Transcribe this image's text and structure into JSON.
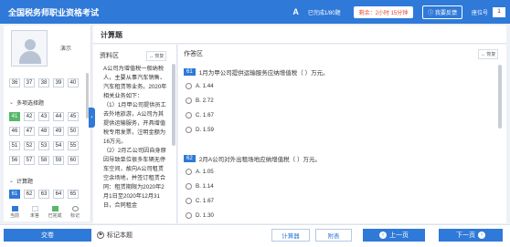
{
  "app": {
    "title": "全国税务师职业资格考试",
    "font_toggle": "A",
    "done_count": "已完成1/80题",
    "timer": "剩余：2小时 15分钟",
    "feedback": "我要反馈",
    "seat_label": "座位号",
    "seat_number": "1"
  },
  "sidebar": {
    "demo_name": "演示",
    "row_top": [
      "36",
      "37",
      "38",
      "39",
      "40"
    ],
    "section_multi": "多项选择题",
    "multi_rows": [
      [
        "41",
        "42",
        "43",
        "44",
        "45"
      ],
      [
        "46",
        "47",
        "48",
        "49",
        "50"
      ],
      [
        "51",
        "52",
        "53",
        "54",
        "55"
      ],
      [
        "56",
        "57",
        "58",
        "59",
        "60"
      ]
    ],
    "section_calc": "计算题",
    "calc_row": [
      "61",
      "62",
      "63",
      "64",
      "65"
    ],
    "legend": [
      "当前",
      "未答",
      "已完成",
      "标记"
    ]
  },
  "main": {
    "section_title": "计算题",
    "material_header": "资料区",
    "answer_header": "作答区",
    "restore": "恢复",
    "material_text": "A公司为增值税一般纳税人，主要从事汽车销售、汽车租赁等业务。2020年相关业务如下：\n（1）1月甲公司提供员工去外地旅游，A公司为其提供运输服务，开具增值税专用发票，注明金额为16万元。\n（2）2月乙公司因自身原因导致单位很多车辆无停车空间，故向A公司租赁空余场地，并签订租赁合同：租赁期限为2020年2月1日至2020年12月31日，合同租金",
    "questions": [
      {
        "no": "61",
        "text": "1月为甲公司提供运输服务应纳增值税（    ）万元。",
        "options": [
          {
            "letter": "A.",
            "value": "1.44"
          },
          {
            "letter": "B.",
            "value": "2.72"
          },
          {
            "letter": "C.",
            "value": "1.67"
          },
          {
            "letter": "D.",
            "value": "1.59"
          }
        ]
      },
      {
        "no": "62",
        "text": "2月A公司对外出租场地应纳增值税（    ）万元。",
        "options": [
          {
            "letter": "A.",
            "value": "1.05"
          },
          {
            "letter": "B.",
            "value": "1.14"
          },
          {
            "letter": "C.",
            "value": "1.67"
          },
          {
            "letter": "D.",
            "value": "1.30"
          }
        ]
      }
    ]
  },
  "bottom": {
    "submit": "交卷",
    "mark": "标记本题",
    "calculator": "计算器",
    "appendix": "附表",
    "prev": "上一页",
    "next": "下一页"
  },
  "colors": {
    "accent": "#2f79d8",
    "done_green": "#56b86a",
    "timer_red": "#e04b2c"
  }
}
